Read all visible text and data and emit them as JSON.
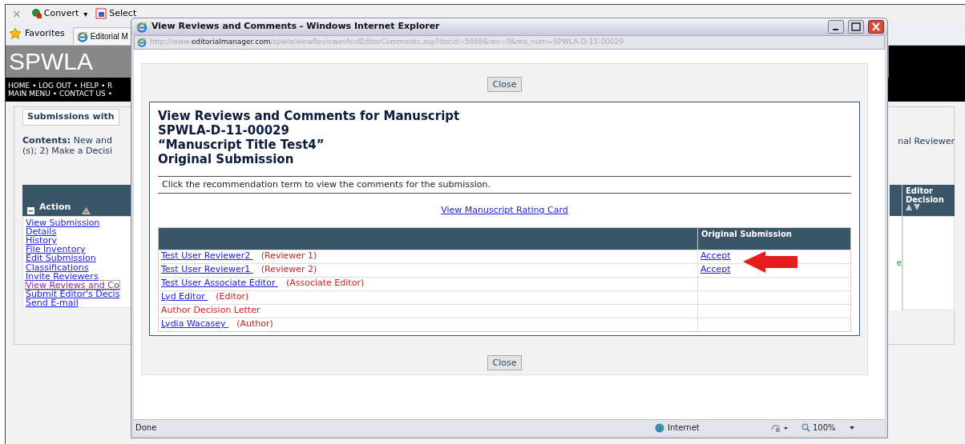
{
  "browser": {
    "toolbar": [
      {
        "kind": "close",
        "label": "×"
      },
      {
        "kind": "convert",
        "label": "Convert"
      },
      {
        "kind": "dropdown",
        "label": "▾"
      },
      {
        "kind": "select",
        "label": "Select"
      }
    ],
    "favorites": "Favorites",
    "tab": "Editorial M"
  },
  "background_page": {
    "logo": "SPWLA",
    "nav_lines": [
      "HOME • LOG OUT • HELP • R",
      "MAIN MENU • CONTACT US •"
    ],
    "panel_tab": "Submissions with",
    "contents_label": "Contents:",
    "contents_lines": [
      "New and",
      "(s); 2) Make a Decisi"
    ],
    "right_text": "nal Reviewer",
    "action_header": "Action",
    "actions": [
      {
        "label": "View Submission",
        "visited": false
      },
      {
        "label": "Details",
        "visited": false
      },
      {
        "label": "History",
        "visited": false
      },
      {
        "label": "File Inventory",
        "visited": false
      },
      {
        "label": "Edit Submission",
        "visited": false
      },
      {
        "label": "Classifications",
        "visited": false
      },
      {
        "label": "Invite Reviewers",
        "visited": false
      },
      {
        "label": "View Reviews and Co",
        "visited": true
      },
      {
        "label": "Submit Editor's Decis",
        "visited": false
      },
      {
        "label": "Send E-mail",
        "visited": false
      }
    ],
    "editor_decision_header": "Editor Decision",
    "fragment": "e"
  },
  "popup": {
    "title": "View Reviews and Comments - Windows Internet Explorer",
    "url": {
      "prefix": "http://www.",
      "domain": "editorialmanager.com",
      "path": "/spwla/viewReviewerAndEditorComments.asp?docid=5668&rev=0&ms_num=SPWLA-D-11-00029"
    },
    "close_buttons": [
      "Close",
      "Close"
    ],
    "heading_lines": [
      "View Reviews and Comments for Manuscript",
      "SPWLA-D-11-00029",
      "“Manuscript Title Test4”",
      "Original Submission"
    ],
    "instruction": "Click the recommendation term to view the comments for the submission.",
    "rating_link": "View Manuscript Rating Card",
    "table": {
      "columns": [
        "Original Submission"
      ],
      "rows": [
        {
          "kind": "person",
          "name": "Test User Reviewer2",
          "role": "(Reviewer 1)",
          "decision": "Accept"
        },
        {
          "kind": "person",
          "name": "Test User Reviewer1",
          "role": "(Reviewer 2)",
          "decision": "Accept"
        },
        {
          "kind": "person",
          "name": "Test User Associate Editor",
          "role": "(Associate Editor)"
        },
        {
          "kind": "person",
          "name": "Lyd Editor",
          "role": "(Editor)"
        },
        {
          "kind": "letter",
          "name": "Author Decision Letter"
        },
        {
          "kind": "person",
          "name": "Lydia Wacasey",
          "role": "(Author)"
        }
      ]
    },
    "status": {
      "text": "Done",
      "zone": "Internet",
      "zoom": "100%"
    }
  }
}
